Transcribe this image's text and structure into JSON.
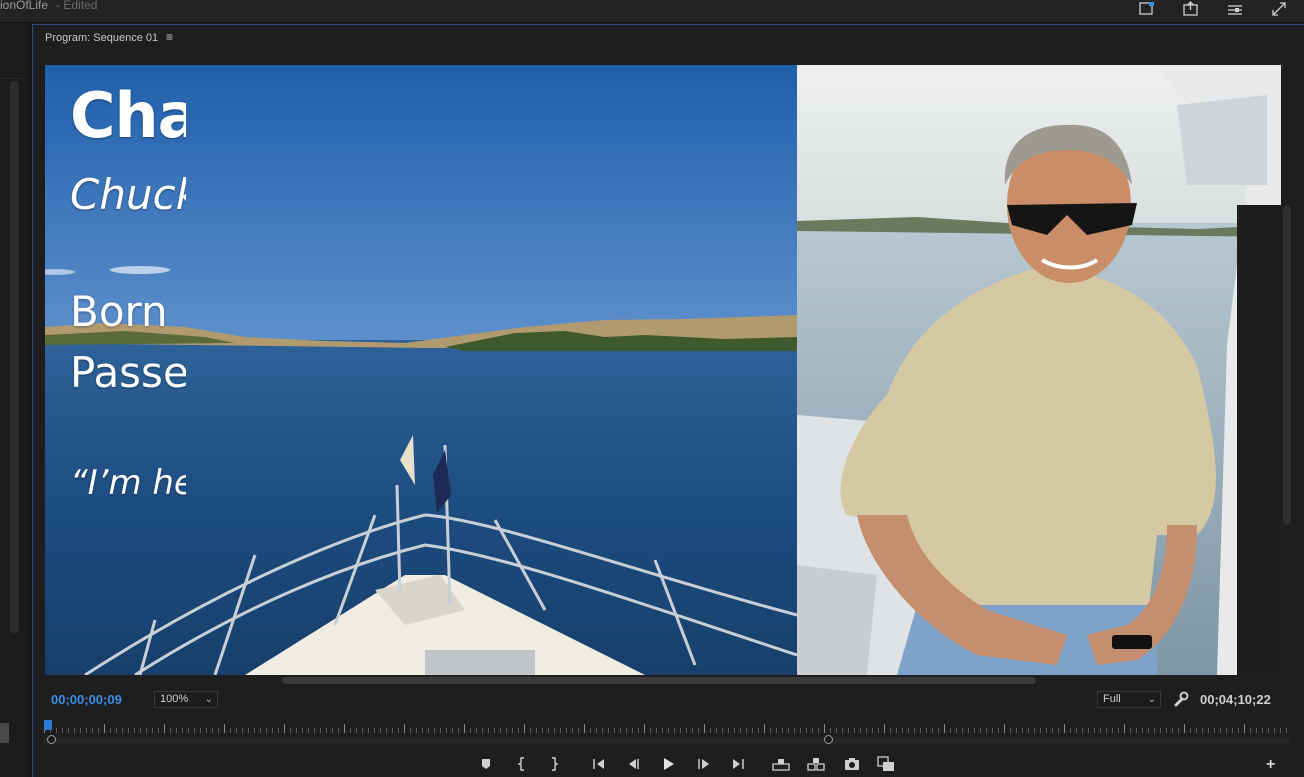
{
  "app": {
    "project_title": "ionOfLife",
    "edited_label": "- Edited"
  },
  "panel": {
    "title": "Program: Sequence 01",
    "menu_icon": "hamburger-menu-icon"
  },
  "overlay": {
    "name": "Cha",
    "nickname": "Chuck",
    "born": "Born",
    "passed": "Passe",
    "quote": "“I’m he"
  },
  "controls": {
    "current_timecode": "00;00;00;09",
    "zoom_level": "100%",
    "resolution": "Full",
    "duration_timecode": "00;04;10;22"
  },
  "playback": {
    "playhead_fraction": 0.003
  },
  "transport": {
    "buttons": [
      "add-marker-icon",
      "mark-in-icon",
      "mark-out-icon",
      "go-to-in-icon",
      "step-back-icon",
      "play-icon",
      "step-forward-icon",
      "go-to-out-icon",
      "lift-icon",
      "extract-icon",
      "export-frame-icon",
      "compare-view-icon",
      "add-button-icon"
    ]
  },
  "colors": {
    "accent": "#2e7bd6",
    "timecode": "#3a8ee6",
    "panel_border": "#2a4a80"
  }
}
